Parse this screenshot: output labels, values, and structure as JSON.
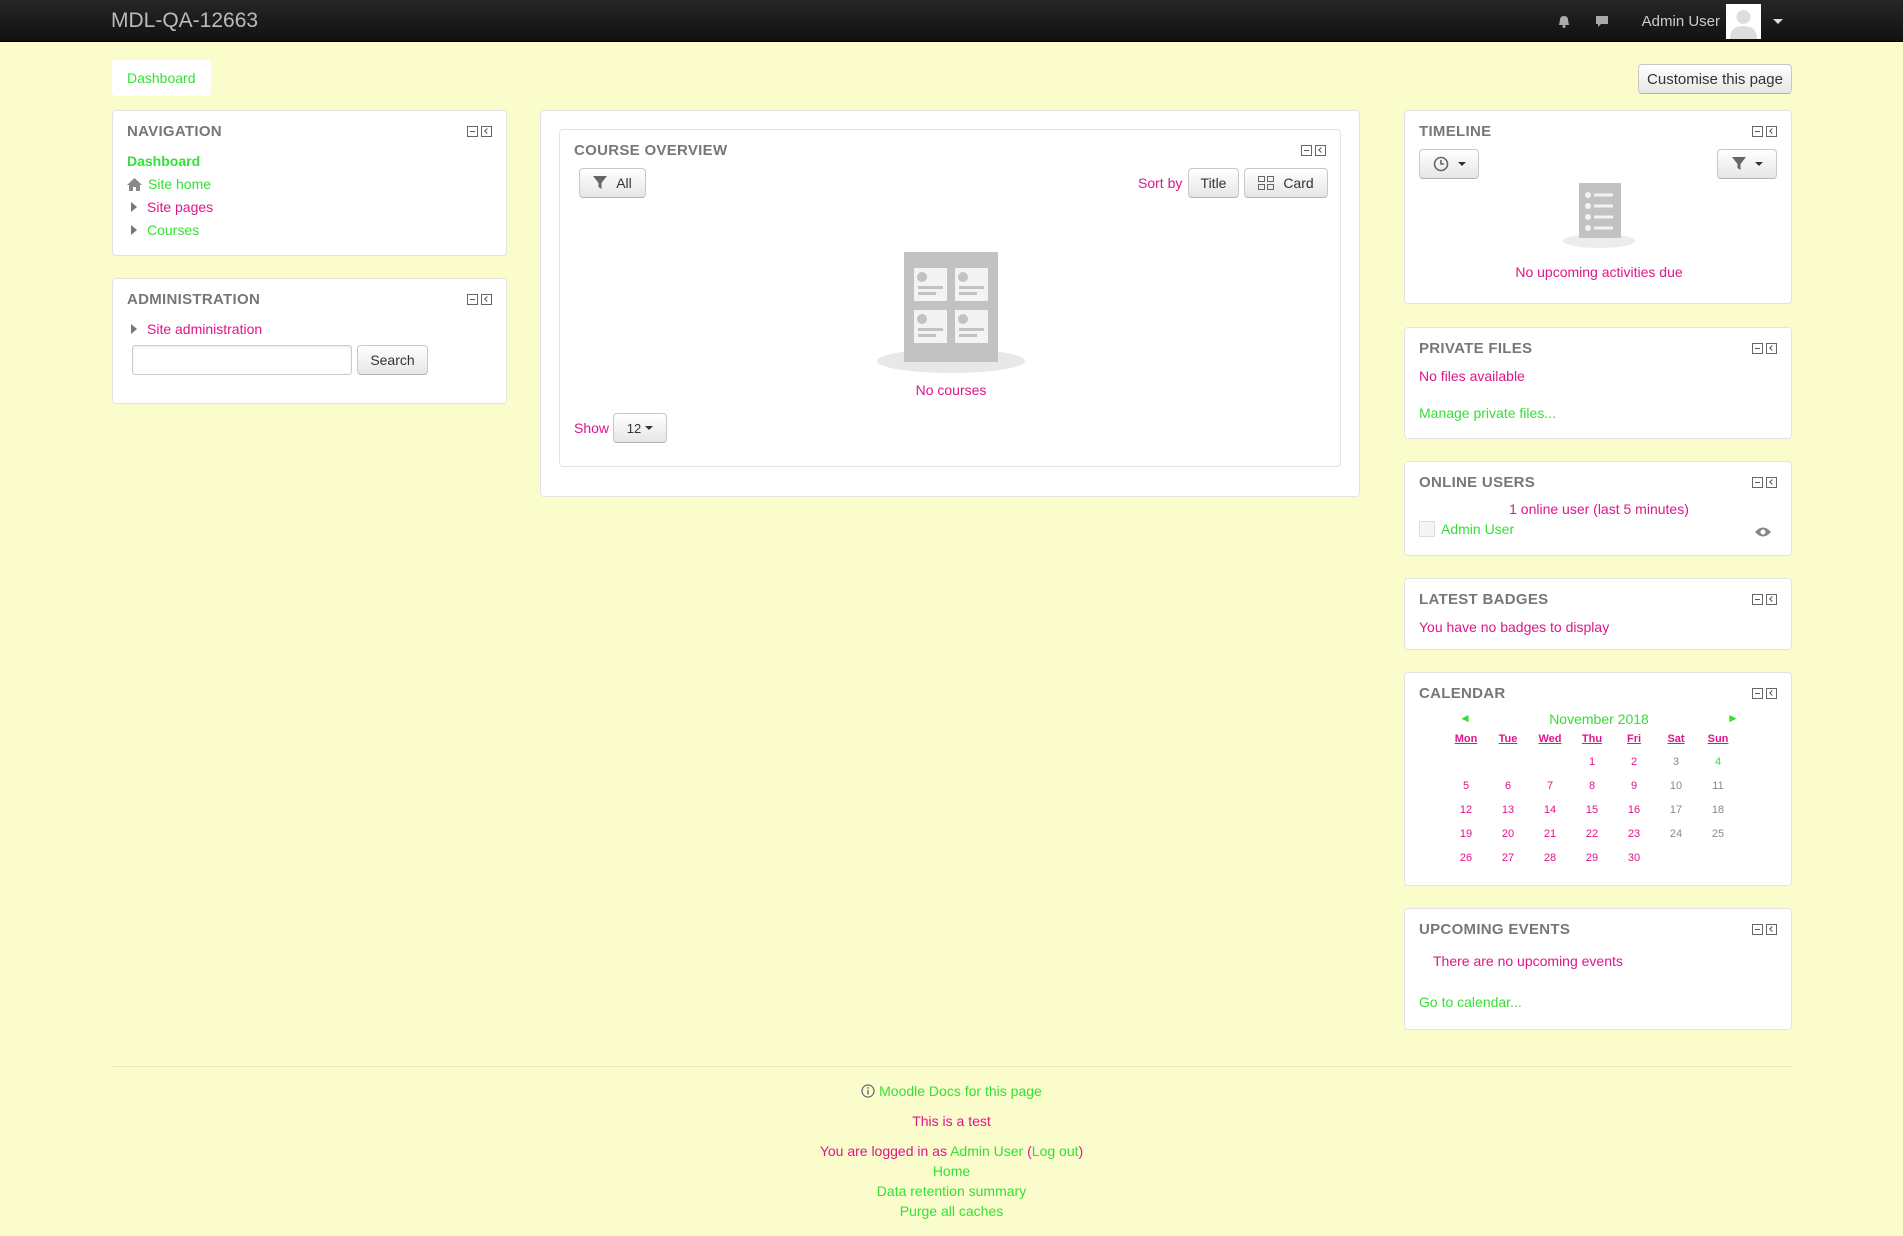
{
  "navbar": {
    "brand": "MDL-QA-12663",
    "user_name": "Admin User"
  },
  "breadcrumb": {
    "dashboard": "Dashboard"
  },
  "customise_button": "Customise this page",
  "navigation": {
    "title": "NAVIGATION",
    "items": [
      "Dashboard",
      "Site home",
      "Site pages",
      "Courses"
    ]
  },
  "administration": {
    "title": "ADMINISTRATION",
    "site_admin": "Site administration",
    "search_button": "Search",
    "search_value": ""
  },
  "course_overview": {
    "title": "COURSE OVERVIEW",
    "filter_label": "All",
    "sort_by_label": "Sort by",
    "sort_title": "Title",
    "view_card": "Card",
    "empty_text": "No courses",
    "show_label": "Show",
    "show_value": "12"
  },
  "timeline": {
    "title": "TIMELINE",
    "empty_text": "No upcoming activities due"
  },
  "private_files": {
    "title": "PRIVATE FILES",
    "empty_text": "No files available",
    "manage_link": "Manage private files..."
  },
  "online_users": {
    "title": "ONLINE USERS",
    "summary": "1 online user (last 5 minutes)",
    "user": "Admin User"
  },
  "latest_badges": {
    "title": "LATEST BADGES",
    "empty_text": "You have no badges to display"
  },
  "calendar": {
    "title": "CALENDAR",
    "month": "November 2018",
    "prev": "◄",
    "next": "►",
    "days": [
      "Mon",
      "Tue",
      "Wed",
      "Thu",
      "Fri",
      "Sat",
      "Sun"
    ],
    "weeks": [
      [
        "",
        "",
        "",
        "1",
        "2",
        "3",
        "4"
      ],
      [
        "5",
        "6",
        "7",
        "8",
        "9",
        "10",
        "11"
      ],
      [
        "12",
        "13",
        "14",
        "15",
        "16",
        "17",
        "18"
      ],
      [
        "19",
        "20",
        "21",
        "22",
        "23",
        "24",
        "25"
      ],
      [
        "26",
        "27",
        "28",
        "29",
        "30",
        "",
        ""
      ]
    ],
    "today": "4"
  },
  "upcoming_events": {
    "title": "UPCOMING EVENTS",
    "empty_text": "There are no upcoming events",
    "calendar_link": "Go to calendar..."
  },
  "footer": {
    "docs_link": "Moodle Docs for this page",
    "test_text": "This is a test",
    "logged_in_prefix": "You are logged in as",
    "logged_in_user": "Admin User",
    "logout_link": "Log out",
    "home_link": "Home",
    "data_retention_link": "Data retention summary",
    "purge_link": "Purge all caches"
  },
  "colors": {
    "background": "#fafccc",
    "link_green": "#35e035",
    "text_pink": "#e0158a"
  }
}
